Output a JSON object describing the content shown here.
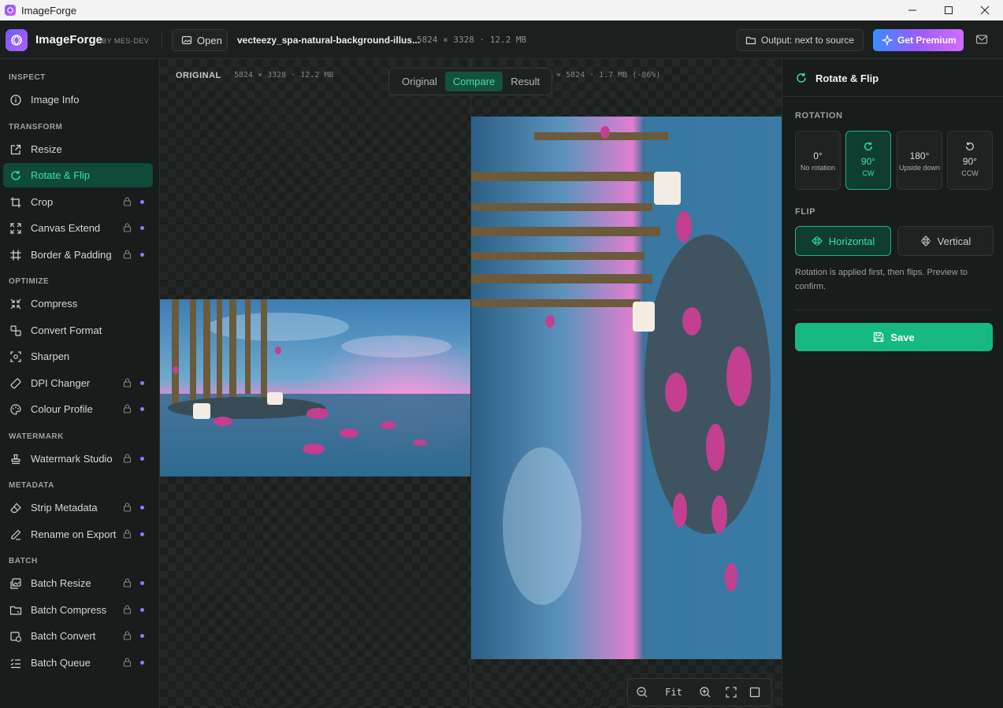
{
  "window": {
    "title": "ImageForge"
  },
  "app": {
    "brand": "ImageForge",
    "by": "BY MES-DEV"
  },
  "toolbar": {
    "open_label": "Open",
    "file_name": "vecteezy_spa-natural-background-illus...",
    "file_meta": "5824 × 3328 · 12.2 MB",
    "output_label": "Output: next to source",
    "premium_label": "Get Premium"
  },
  "sidebar": {
    "sections": {
      "inspect": "INSPECT",
      "transform": "TRANSFORM",
      "optimize": "OPTIMIZE",
      "watermark": "WATERMARK",
      "metadata": "METADATA",
      "batch": "BATCH"
    },
    "items": [
      {
        "label": "Image Info",
        "icon": "info-icon"
      },
      {
        "label": "Resize",
        "icon": "resize-icon"
      },
      {
        "label": "Rotate & Flip",
        "icon": "rotate-icon",
        "active": true
      },
      {
        "label": "Crop",
        "icon": "crop-icon",
        "locked": true
      },
      {
        "label": "Canvas Extend",
        "icon": "expand-icon",
        "locked": true
      },
      {
        "label": "Border & Padding",
        "icon": "border-icon",
        "locked": true
      },
      {
        "label": "Compress",
        "icon": "compress-icon"
      },
      {
        "label": "Convert Format",
        "icon": "convert-icon"
      },
      {
        "label": "Sharpen",
        "icon": "sharpen-icon"
      },
      {
        "label": "DPI Changer",
        "icon": "ruler-icon",
        "locked": true
      },
      {
        "label": "Colour Profile",
        "icon": "palette-icon",
        "locked": true
      },
      {
        "label": "Watermark Studio",
        "icon": "stamp-icon",
        "locked": true
      },
      {
        "label": "Strip Metadata",
        "icon": "eraser-icon",
        "locked": true
      },
      {
        "label": "Rename on Export",
        "icon": "pen-icon",
        "locked": true
      },
      {
        "label": "Batch Resize",
        "icon": "images-icon",
        "locked": true
      },
      {
        "label": "Batch Compress",
        "icon": "folder-icon",
        "locked": true
      },
      {
        "label": "Batch Convert",
        "icon": "batch-convert-icon",
        "locked": true
      },
      {
        "label": "Batch Queue",
        "icon": "list-icon",
        "locked": true
      }
    ]
  },
  "canvas": {
    "original_label": "ORIGINAL",
    "original_meta": "5824 × 3328 · 12.2 MB",
    "result_meta": "× 5824 · 1.7 MB (-86%)",
    "view_modes": [
      "Original",
      "Compare",
      "Result"
    ],
    "active_view": "Compare",
    "zoom_label": "Fit"
  },
  "panel": {
    "title": "Rotate & Flip",
    "rotation_label": "ROTATION",
    "rotations": [
      {
        "deg": "0°",
        "sub": "No rotation"
      },
      {
        "deg": "90°",
        "sub": "CW",
        "active": true
      },
      {
        "deg": "180°",
        "sub": "Upside down"
      },
      {
        "deg": "90°",
        "sub": "CCW"
      }
    ],
    "flip_label": "FLIP",
    "flip_horizontal": "Horizontal",
    "flip_vertical": "Vertical",
    "note": "Rotation is applied first, then flips. Preview to confirm.",
    "save_label": "Save"
  },
  "colors": {
    "accent": "#16b981",
    "accent_text": "#3fe0a8",
    "lock_dot": "#8f7cff"
  }
}
